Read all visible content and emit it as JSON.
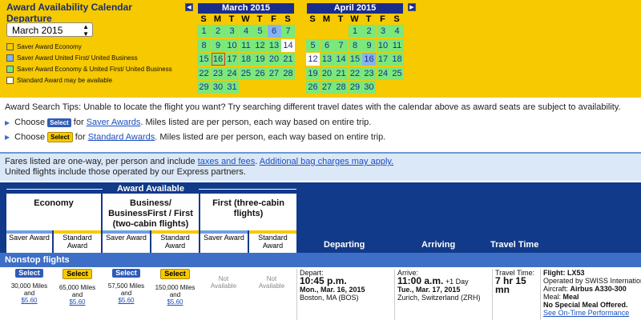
{
  "calendar": {
    "title_line1": "Award Availability Calendar",
    "title_line2": "Departure",
    "month_select": "March 2015",
    "legend": [
      {
        "label": "Saver Award Economy",
        "color": "#f6c900"
      },
      {
        "label": "Saver Award United First/ United Business",
        "color": "#86b4ee"
      },
      {
        "label": "Saver Award Economy & United First/ United Business",
        "color": "#7ae87a"
      },
      {
        "label": "Standard Award may be available",
        "color": "#ffffff"
      }
    ],
    "prev_icon": "◀",
    "next_icon": "▶",
    "dow": [
      "S",
      "M",
      "T",
      "W",
      "T",
      "F",
      "S"
    ],
    "march": {
      "name": "March 2015",
      "weeks": [
        [
          {
            "d": "1",
            "c": "green"
          },
          {
            "d": "2",
            "c": "green"
          },
          {
            "d": "3",
            "c": "green"
          },
          {
            "d": "4",
            "c": "green"
          },
          {
            "d": "5",
            "c": "green"
          },
          {
            "d": "6",
            "c": "blue"
          },
          {
            "d": "7",
            "c": "green"
          }
        ],
        [
          {
            "d": "8",
            "c": "green"
          },
          {
            "d": "9",
            "c": "green"
          },
          {
            "d": "10",
            "c": "green"
          },
          {
            "d": "11",
            "c": "green"
          },
          {
            "d": "12",
            "c": "green"
          },
          {
            "d": "13",
            "c": "green"
          },
          {
            "d": "14",
            "c": "white"
          }
        ],
        [
          {
            "d": "15",
            "c": "green"
          },
          {
            "d": "16",
            "c": "green boxed"
          },
          {
            "d": "17",
            "c": "green"
          },
          {
            "d": "18",
            "c": "green"
          },
          {
            "d": "19",
            "c": "green"
          },
          {
            "d": "20",
            "c": "green"
          },
          {
            "d": "21",
            "c": "green"
          }
        ],
        [
          {
            "d": "22",
            "c": "green"
          },
          {
            "d": "23",
            "c": "green"
          },
          {
            "d": "24",
            "c": "green"
          },
          {
            "d": "25",
            "c": "green"
          },
          {
            "d": "26",
            "c": "green"
          },
          {
            "d": "27",
            "c": "green"
          },
          {
            "d": "28",
            "c": "green"
          }
        ],
        [
          {
            "d": "29",
            "c": "green"
          },
          {
            "d": "30",
            "c": "green"
          },
          {
            "d": "31",
            "c": "green"
          }
        ]
      ]
    },
    "april": {
      "name": "April 2015",
      "weeks": [
        [
          {
            "d": "",
            "c": ""
          },
          {
            "d": "",
            "c": ""
          },
          {
            "d": "",
            "c": ""
          },
          {
            "d": "1",
            "c": "green"
          },
          {
            "d": "2",
            "c": "green"
          },
          {
            "d": "3",
            "c": "green"
          },
          {
            "d": "4",
            "c": "green"
          }
        ],
        [
          {
            "d": "5",
            "c": "green"
          },
          {
            "d": "6",
            "c": "green"
          },
          {
            "d": "7",
            "c": "green"
          },
          {
            "d": "8",
            "c": "green"
          },
          {
            "d": "9",
            "c": "green"
          },
          {
            "d": "10",
            "c": "green"
          },
          {
            "d": "11",
            "c": "green"
          }
        ],
        [
          {
            "d": "12",
            "c": "white"
          },
          {
            "d": "13",
            "c": "green"
          },
          {
            "d": "14",
            "c": "green"
          },
          {
            "d": "15",
            "c": "green"
          },
          {
            "d": "16",
            "c": "blue"
          },
          {
            "d": "17",
            "c": "green"
          },
          {
            "d": "18",
            "c": "green"
          }
        ],
        [
          {
            "d": "19",
            "c": "green"
          },
          {
            "d": "20",
            "c": "green"
          },
          {
            "d": "21",
            "c": "green"
          },
          {
            "d": "22",
            "c": "green"
          },
          {
            "d": "23",
            "c": "green"
          },
          {
            "d": "24",
            "c": "green"
          },
          {
            "d": "25",
            "c": "green"
          }
        ],
        [
          {
            "d": "26",
            "c": "green"
          },
          {
            "d": "27",
            "c": "green"
          },
          {
            "d": "28",
            "c": "green"
          },
          {
            "d": "29",
            "c": "green"
          },
          {
            "d": "30",
            "c": "green"
          }
        ]
      ]
    }
  },
  "tips": {
    "text": "Award Search Tips: Unable to locate the flight you want? Try searching different travel dates with the calendar above as award seats are subject to availability.",
    "choose": "Choose",
    "select": "Select",
    "for": "for",
    "saver_link": "Saver Awards",
    "standard_link": "Standard Awards",
    "tail": ". Miles listed are per person, each way based on entire trip."
  },
  "fares": {
    "line1_pre": "Fares listed are one-way, per person and include ",
    "taxes_link": "taxes and fees",
    "line1_mid": ". ",
    "bag_link": "Additional bag charges may apply.",
    "line2": "United flights include those operated by our Express partners."
  },
  "table": {
    "award_available": "Award Available",
    "col_economy": "Economy",
    "col_business": "Business/ BusinessFirst / First (two-cabin flights)",
    "col_first": "First (three-cabin flights)",
    "saver_award": "Saver Award",
    "standard_award": "Standard Award",
    "departing": "Departing",
    "arriving": "Arriving",
    "travel_time": "Travel Time",
    "nonstop": "Nonstop flights"
  },
  "flight": {
    "select": "Select",
    "not_available": "Not Available",
    "eco_saver_miles": "30,000 Miles",
    "eco_std_miles": "65,000 Miles",
    "bus_saver_miles": "57,500 Miles",
    "bus_std_miles": "150,000 Miles",
    "and": "and",
    "fee": "$5.60",
    "depart_label": "Depart:",
    "depart_time": "10:45 p.m.",
    "depart_date": "Mon., Mar. 16, 2015",
    "depart_city": "Boston, MA (BOS)",
    "arrive_label": "Arrive:",
    "arrive_time": "11:00 a.m.",
    "arrive_plus": "+1 Day",
    "arrive_date": "Tue., Mar. 17, 2015",
    "arrive_city": "Zurich, Switzerland (ZRH)",
    "tt_label": "Travel Time:",
    "tt_value": "7 hr 15 mn",
    "flight_no": "Flight: LX53",
    "operated": "Operated by SWISS International Airlines.",
    "aircraft_label": "Aircraft: ",
    "aircraft": "Airbus A330-300",
    "meal_label": "Meal: ",
    "meal": "Meal",
    "special": "No Special Meal Offered.",
    "ontime": "See On-Time Performance"
  }
}
